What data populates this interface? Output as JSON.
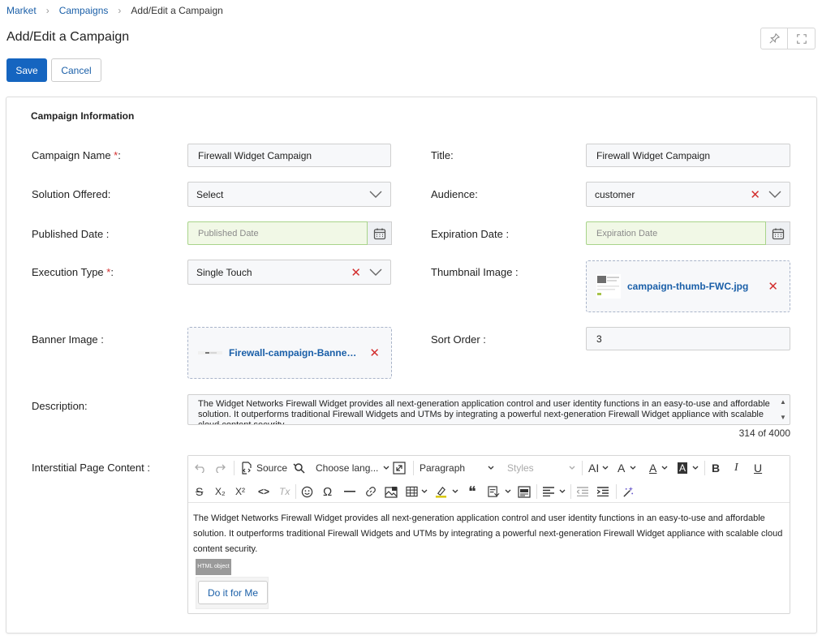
{
  "breadcrumb": {
    "items": [
      "Market",
      "Campaigns"
    ],
    "current": "Add/Edit a Campaign"
  },
  "page_title": "Add/Edit a Campaign",
  "header_icons": [
    "pin-icon",
    "fullscreen-icon"
  ],
  "actions": {
    "save": "Save",
    "cancel": "Cancel"
  },
  "section_title": "Campaign Information",
  "fields": {
    "campaign_name": {
      "label": "Campaign Name ",
      "required": "*",
      "suffix": ":",
      "value": "Firewall Widget Campaign"
    },
    "title": {
      "label": "Title:",
      "value": "Firewall Widget Campaign"
    },
    "solution_offered": {
      "label": "Solution Offered:",
      "value": "Select"
    },
    "audience": {
      "label": "Audience:",
      "value": "customer"
    },
    "published_date": {
      "label": "Published Date :",
      "placeholder": "Published Date"
    },
    "expiration_date": {
      "label": "Expiration Date :",
      "placeholder": "Expiration Date"
    },
    "execution_type": {
      "label": "Execution Type ",
      "required": "*",
      "suffix": ":",
      "value": "Single Touch"
    },
    "thumbnail_image": {
      "label": "Thumbnail Image :",
      "file": "campaign-thumb-FWC.jpg"
    },
    "banner_image": {
      "label": "Banner Image :",
      "file": "Firewall-campaign-Banner.j..."
    },
    "sort_order": {
      "label": "Sort Order :",
      "value": "3"
    },
    "description": {
      "label": "Description:",
      "value": "The Widget Networks Firewall Widget provides all next-generation application control and user identity functions in an easy-to-use and affordable solution. It outperforms traditional Firewall Widgets and UTMs by integrating a powerful next-generation Firewall Widget appliance with scalable cloud content security.",
      "count": "314 of 4000"
    },
    "interstitial": {
      "label": "Interstitial Page Content :",
      "body": "The Widget Networks Firewall Widget provides all next-generation application control and user identity functions in an easy-to-use and affordable solution. It outperforms traditional Firewall Widgets and UTMs by integrating a powerful next-generation Firewall Widget appliance with scalable cloud content security.",
      "html_object": "HTML object",
      "button": "Do it for Me"
    }
  },
  "toolbar": {
    "source": "Source",
    "language": "Choose lang...",
    "heading": "Paragraph",
    "styles": "Styles",
    "font_size": "AI",
    "font_family": "A",
    "font_color": "A",
    "bg_color": "A",
    "bold": "B",
    "italic": "I",
    "underline": "U",
    "strike": "S",
    "subscript": "X₂",
    "superscript": "X²",
    "code": "<>",
    "remove_format": "Tx",
    "special_char": "Ω",
    "blockquote": "❝"
  },
  "colors": {
    "accent": "#1565c0",
    "link": "#1a5fa8",
    "required": "#d32f2f",
    "date_bg": "#f1f8e6"
  }
}
